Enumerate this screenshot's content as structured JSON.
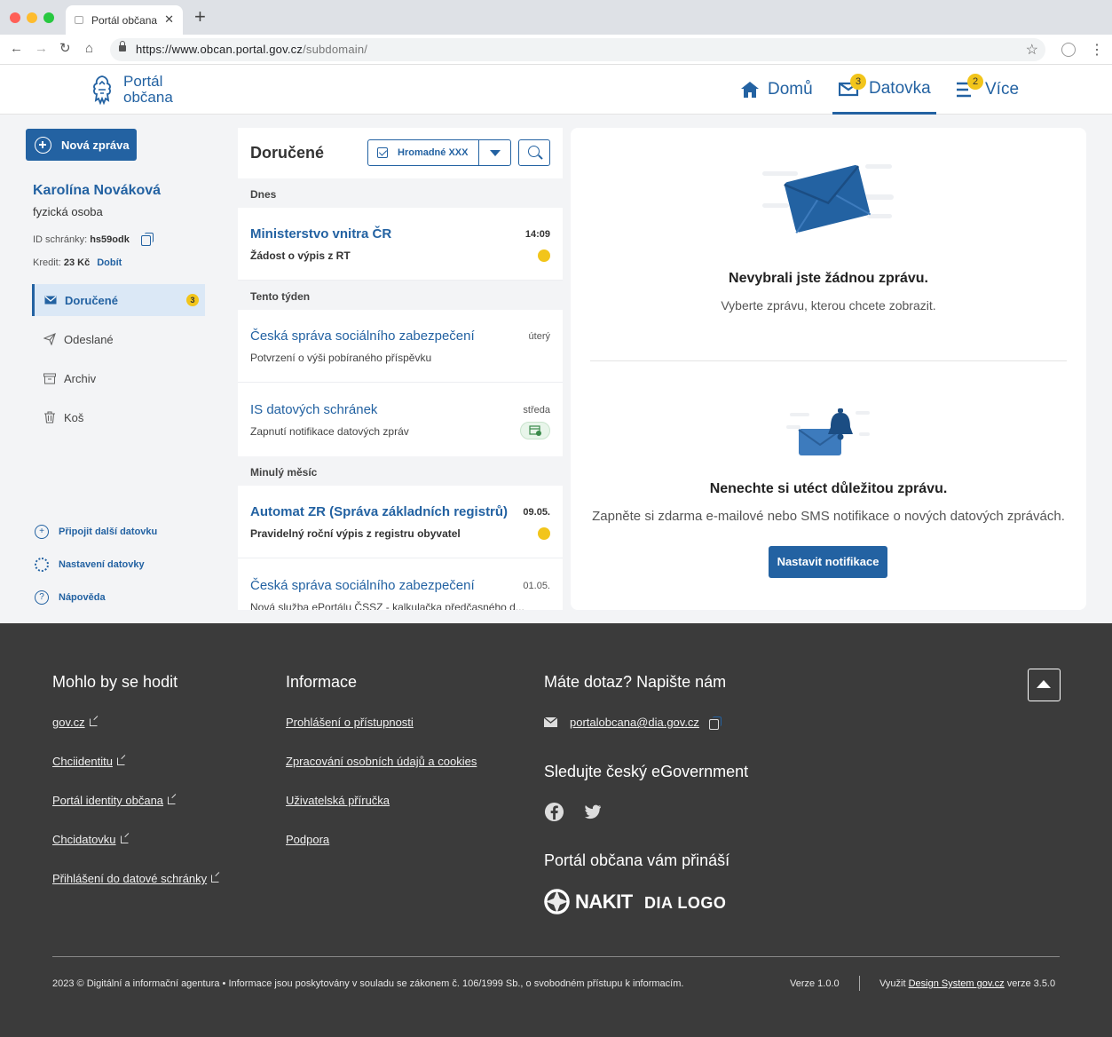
{
  "browser": {
    "tab_title": "Portál občana",
    "url_main": "https://www.obcan.portal.gov.cz",
    "url_path": "/subdomain/"
  },
  "header": {
    "logo_line1": "Portál",
    "logo_line2": "občana",
    "nav": [
      {
        "label": "Domů"
      },
      {
        "label": "Datovka",
        "badge": "3"
      },
      {
        "label": "Více",
        "badge": "2"
      }
    ]
  },
  "sidebar": {
    "new_message": "Nová zpráva",
    "user_name": "Karolína Nováková",
    "user_type": "fyzická osoba",
    "id_label": "ID schránky:",
    "id_value": "hs59odk",
    "credit_label": "Kredit:",
    "credit_value": "23 Kč",
    "credit_link": "Dobít",
    "items": [
      {
        "label": "Doručené",
        "badge": "3"
      },
      {
        "label": "Odeslané"
      },
      {
        "label": "Archiv"
      },
      {
        "label": "Koš"
      }
    ],
    "links": [
      {
        "label": "Připojit další datovku"
      },
      {
        "label": "Nastavení datovky"
      },
      {
        "label": "Nápověda"
      }
    ]
  },
  "inbox": {
    "title": "Doručené",
    "bulk_label": "Hromadné XXX",
    "groups": [
      {
        "label": "Dnes"
      },
      {
        "label": "Tento týden"
      },
      {
        "label": "Minulý měsíc"
      }
    ],
    "messages": [
      {
        "sender": "Ministerstvo vnitra ČR",
        "subject": "Žádost o výpis z RT",
        "time": "14:09"
      },
      {
        "sender": "Česká správa sociálního zabezpečení",
        "subject": "Potvrzení o výši pobíraného příspěvku",
        "time": "úterý"
      },
      {
        "sender": "IS datových schránek",
        "subject": "Zapnutí notifikace datových zpráv",
        "time": "středa"
      },
      {
        "sender": "Automat ZR (Správa základních registrů)",
        "subject": "Pravidelný roční výpis z registru obyvatel",
        "time": "09.05."
      },
      {
        "sender": "Česká správa sociálního zabezpečení",
        "subject": "Nová služba ePortálu ČSSZ - kalkulačka předčasného d...",
        "time": "01.05."
      }
    ]
  },
  "panel": {
    "empty_title": "Nevybrali jste žádnou zprávu.",
    "empty_text": "Vyberte zprávu, kterou chcete zobrazit.",
    "notif_title": "Nenechte si utéct důležitou zprávu.",
    "notif_text": "Zapněte si zdarma e-mailové nebo SMS notifikace o nových datových zprávách.",
    "notif_button": "Nastavit notifikace"
  },
  "footer": {
    "col1_title": "Mohlo by se hodit",
    "col1_links": [
      "gov.cz",
      "Chciidentitu",
      "Portál identity občana",
      "Chcidatovku",
      "Přihlášení do datové schránky"
    ],
    "col2_title": "Informace",
    "col2_links": [
      "Prohlášení o přístupnosti",
      "Zpracování osobních údajů a cookies",
      "Uživatelská příručka",
      "Podpora"
    ],
    "col3_title": "Máte dotaz? Napište nám",
    "email": "portalobcana@dia.gov.cz",
    "social_title": "Sledujte český eGovernment",
    "brings_title": "Portál občana vám přináší",
    "logo_nakit": "NAKIT",
    "logo_dia": "DIA LOGO",
    "copyright": "2023 © Digitální a informační agentura • Informace jsou poskytovány v souladu se zákonem č. 106/1999 Sb., o svobodném přístupu k informacím.",
    "version": "Verze 1.0.0",
    "ds_prefix": "Využit",
    "ds_link": "Design System gov.cz",
    "ds_suffix": "verze 3.5.0"
  },
  "colors": {
    "primary": "#2362a2",
    "badge": "#f2c51b",
    "footer_bg": "#3b3b3b",
    "main_bg": "#f3f4f6"
  }
}
